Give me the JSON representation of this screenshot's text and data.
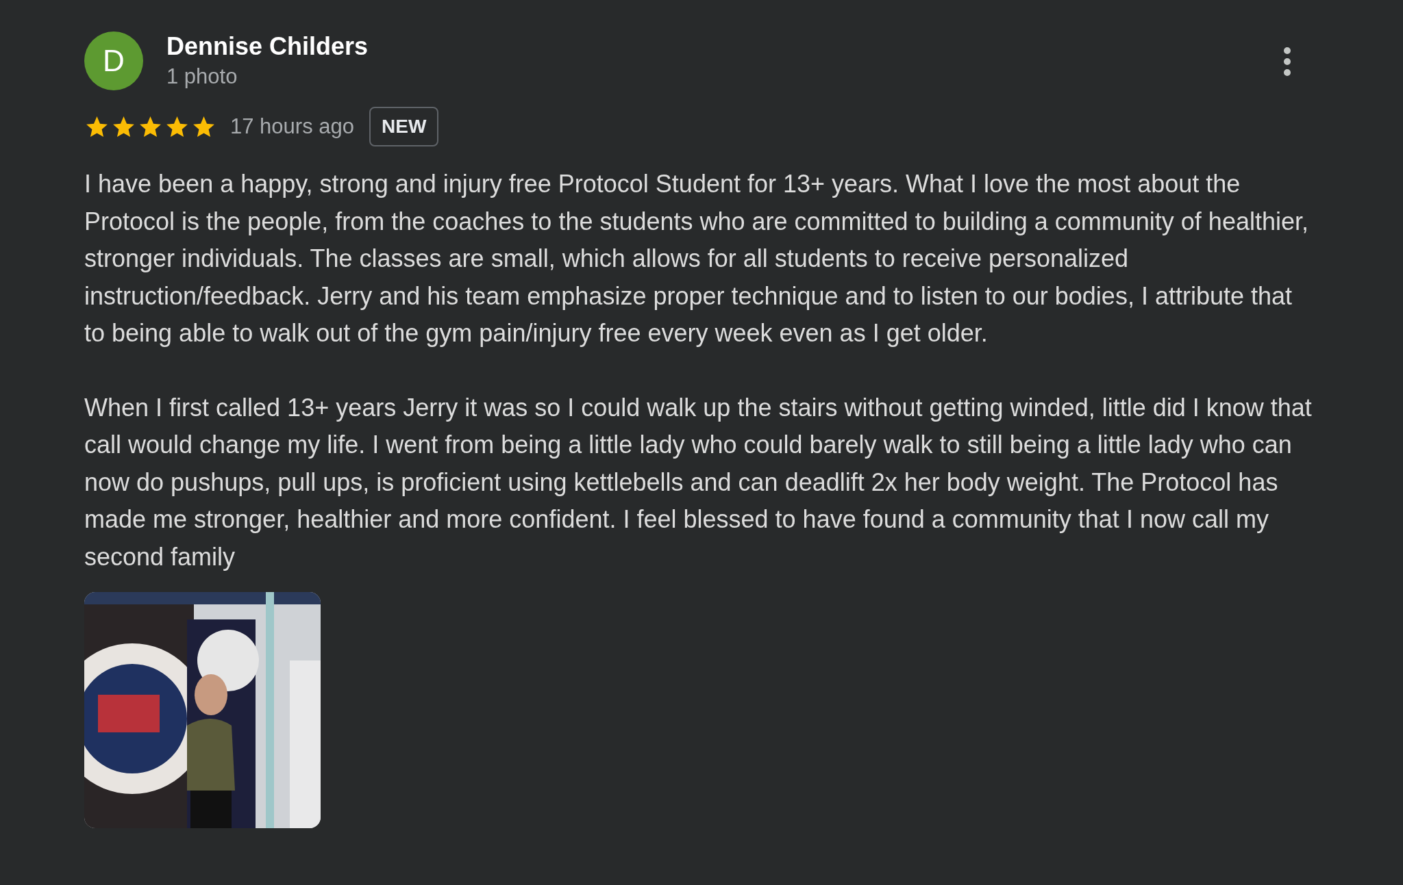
{
  "review": {
    "avatar_letter": "D",
    "name": "Dennise Childers",
    "subtitle": "1 photo",
    "stars": 5,
    "time": "17 hours ago",
    "badge": "NEW",
    "paragraphs": [
      "I have been a happy, strong and injury free Protocol Student for 13+ years. What I love the most about the Protocol is the people, from the coaches to the students who are committed to building a community of healthier, stronger individuals. The classes are small, which allows for all students to receive personalized instruction/feedback. Jerry and his team emphasize proper technique and to listen to our bodies, I attribute that to being able to walk out of the gym pain/injury free every week even as I get older.",
      "When I first called 13+ years Jerry it was so I could walk up the stairs without getting winded, little did I know that call would change my life. I went from being a little lady who could barely walk to still being a little lady who can now do pushups, pull ups, is proficient using kettlebells and can deadlift 2x her body weight. The Protocol has made me stronger, healthier and more confident. I feel blessed to have found a community that I now call my second family"
    ],
    "photos": [
      {
        "kind": "picture"
      }
    ]
  }
}
